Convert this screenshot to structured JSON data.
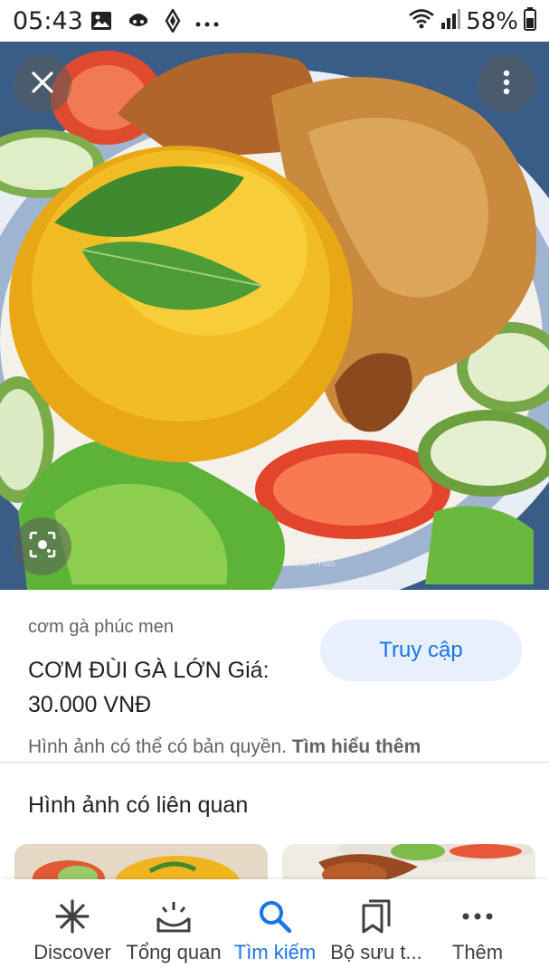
{
  "status_bar": {
    "time": "05:43",
    "battery": "58%",
    "left_icons": [
      "gallery-icon",
      "face-icon",
      "vpn-icon",
      "more-notifications-icon"
    ],
    "right_icons": [
      "wifi-icon",
      "signal-icon",
      "battery-icon"
    ]
  },
  "viewer": {
    "close_icon": "close-icon",
    "more_icon": "more-vert-icon",
    "lens_icon": "lens-icon",
    "image_watermark": "Mai Thảo"
  },
  "info": {
    "source": "cơm gà phúc men",
    "title": "CƠM ĐÙI GÀ LỚN Giá: 30.000 VNĐ",
    "visit_label": "Truy cập",
    "copyright_text": "Hình ảnh có thể có bản quyền.",
    "learn_more": "Tìm hiểu thêm"
  },
  "related": {
    "heading": "Hình ảnh có liên quan"
  },
  "bottom_nav": {
    "items": [
      {
        "label": "Discover",
        "icon": "asterisk-icon",
        "active": false
      },
      {
        "label": "Tổng quan",
        "icon": "inbox-tray-icon",
        "active": false
      },
      {
        "label": "Tìm kiếm",
        "icon": "search-icon",
        "active": true
      },
      {
        "label": "Bộ sưu t...",
        "icon": "bookmarks-icon",
        "active": false
      },
      {
        "label": "Thêm",
        "icon": "more-horiz-icon",
        "active": false
      }
    ]
  },
  "colors": {
    "accent": "#1a73e8",
    "visit_button_bg": "#e8f0fe",
    "text_primary": "#202124",
    "text_secondary": "#5f6368"
  }
}
